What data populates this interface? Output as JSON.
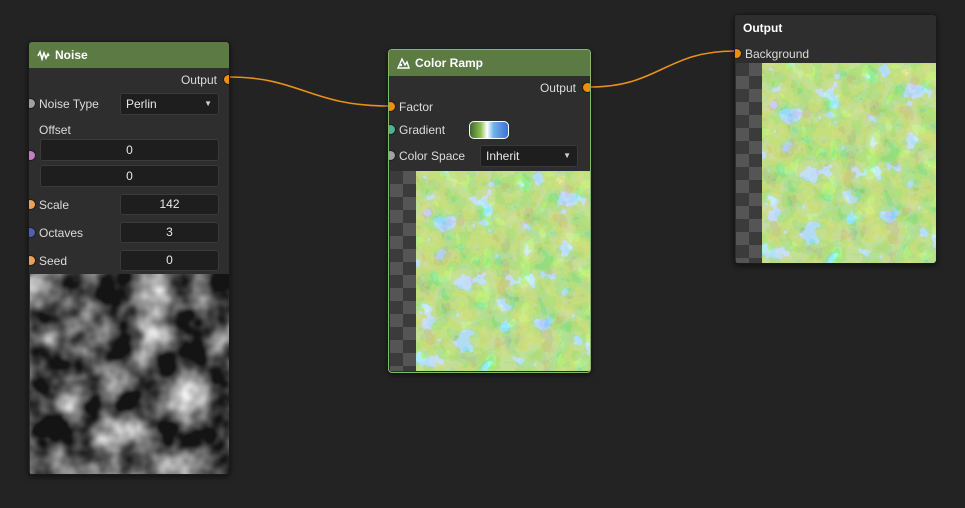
{
  "colors": {
    "canvas_bg": "#232323",
    "node_bg": "#2e2e2e",
    "header_green": "#5b7a44",
    "selected_border": "#86b86a",
    "wire": "#e8901a",
    "socket_float": "#f0a050",
    "socket_output": "#f08c10",
    "socket_enum": "#a0a0a0",
    "socket_vector": "#c080c0",
    "socket_int": "#5060b0",
    "socket_gradient": "#50b090"
  },
  "noise_node": {
    "title": "Noise",
    "icon": "noise-icon",
    "output_label": "Output",
    "noise_type_label": "Noise Type",
    "noise_type_value": "Perlin",
    "offset_label": "Offset",
    "offset_x": "0",
    "offset_y": "0",
    "scale_label": "Scale",
    "scale_value": "142",
    "octaves_label": "Octaves",
    "octaves_value": "3",
    "seed_label": "Seed",
    "seed_value": "0"
  },
  "color_ramp_node": {
    "title": "Color Ramp",
    "icon": "color-ramp-icon",
    "output_label": "Output",
    "factor_label": "Factor",
    "gradient_label": "Gradient",
    "color_space_label": "Color Space",
    "color_space_value": "Inherit"
  },
  "output_node": {
    "title": "Output",
    "background_label": "Background"
  }
}
